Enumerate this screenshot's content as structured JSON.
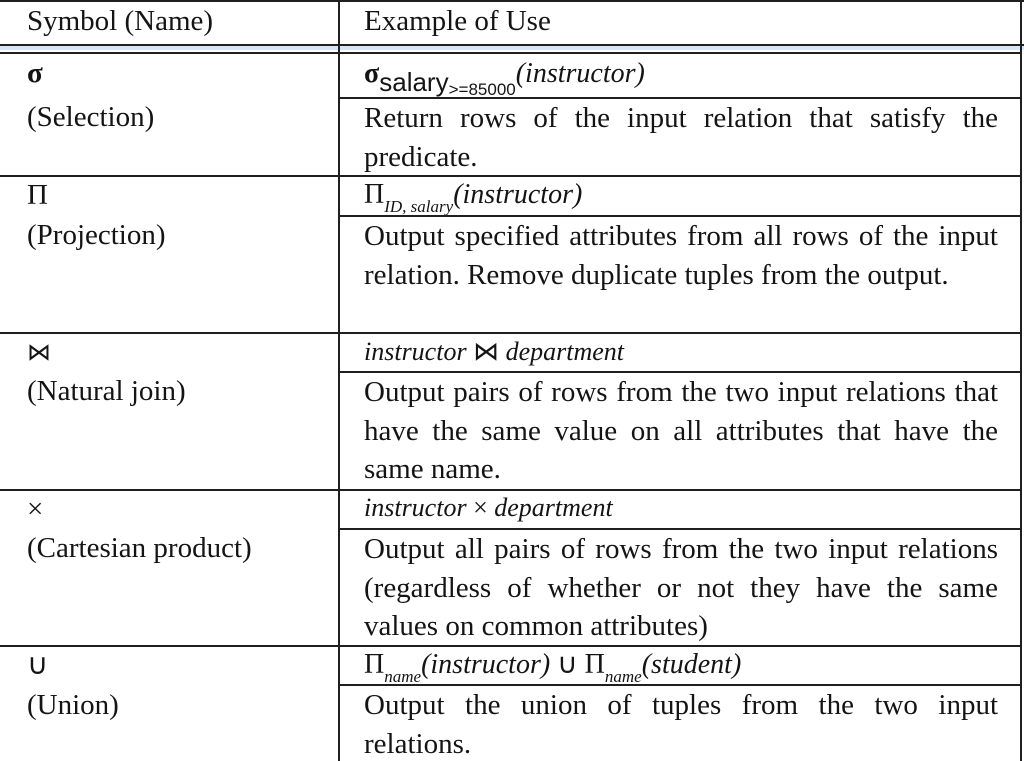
{
  "header": {
    "col1": "Symbol (Name)",
    "col2": "Example of Use"
  },
  "rows": [
    {
      "symbol": "σ",
      "name": "(Selection)",
      "expr": {
        "op": "σ",
        "sub_main": "salary",
        "sub_small": ">=85000",
        "arg": "(instructor)"
      },
      "desc": "Return rows of the input relation that satisfy the predicate."
    },
    {
      "symbol": "Π",
      "name": "(Projection)",
      "expr": {
        "op": "Π",
        "sub": "ID, salary",
        "arg": "(instructor)"
      },
      "desc": "Output specified attributes from all rows of the input relation. Remove duplicate tuples from the output."
    },
    {
      "symbol": "⋈",
      "name": "(Natural join)",
      "expr": {
        "left": "instructor",
        "op": "⋈",
        "right": "department"
      },
      "desc": "Output pairs of rows from the two input relations that have the same value on all attributes that have the same name."
    },
    {
      "symbol": "×",
      "name": "(Cartesian product)",
      "expr": {
        "left": "instructor",
        "op": "×",
        "right": "department"
      },
      "desc": "Output all pairs of rows from the two input relations (regardless of whether or not they have the same values on common attributes)"
    },
    {
      "symbol": "∪",
      "name": "(Union)",
      "expr": {
        "op1": "Π",
        "sub1": "name",
        "arg1": "(instructor)",
        "union": "∪",
        "op2": "Π",
        "sub2": "name",
        "arg2": "(student)"
      },
      "desc": "Output the union of tuples from the two input relations."
    }
  ]
}
